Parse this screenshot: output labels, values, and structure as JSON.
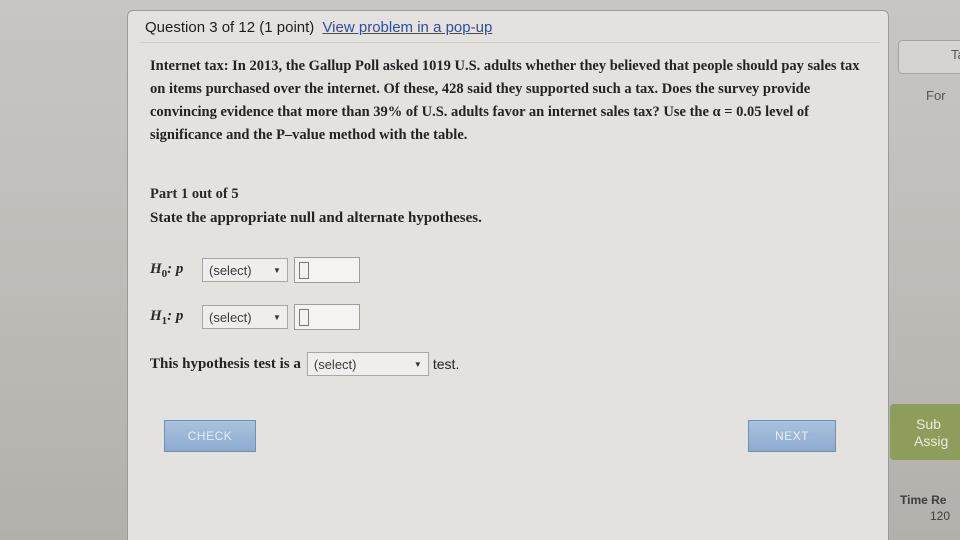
{
  "header": {
    "question_label": "Question 3 of 12",
    "points": "(1 point)",
    "popup_link": "View problem in a pop-up"
  },
  "problem": {
    "text": "Internet tax: In 2013, the Gallup Poll asked 1019 U.S. adults whether they believed that people should pay sales tax on items purchased over the internet. Of these, 428 said they supported such a tax. Does the survey provide convincing evidence that more than 39% of U.S. adults favor an internet sales tax? Use the α = 0.05 level of significance and the P–value method with the table."
  },
  "part": {
    "title": "Part 1 out of 5",
    "instruction": "State the appropriate null and alternate hypotheses."
  },
  "hypotheses": [
    {
      "label": "H",
      "sub": "0",
      "param": ": p",
      "select": "(select)",
      "value": ""
    },
    {
      "label": "H",
      "sub": "1",
      "param": ": p",
      "select": "(select)",
      "value": ""
    }
  ],
  "test_type": {
    "prefix": "This hypothesis test is a",
    "select": "(select)",
    "suffix": "test."
  },
  "buttons": {
    "check": "CHECK",
    "next": "NEXT"
  },
  "side": {
    "tab": "Ta",
    "for_text": "For",
    "submit_line1": "Sub",
    "submit_line2": "Assig",
    "time_line1": "Time Re",
    "time_line2": "120"
  },
  "icons": {
    "dropdown": "chevron-down-icon"
  }
}
